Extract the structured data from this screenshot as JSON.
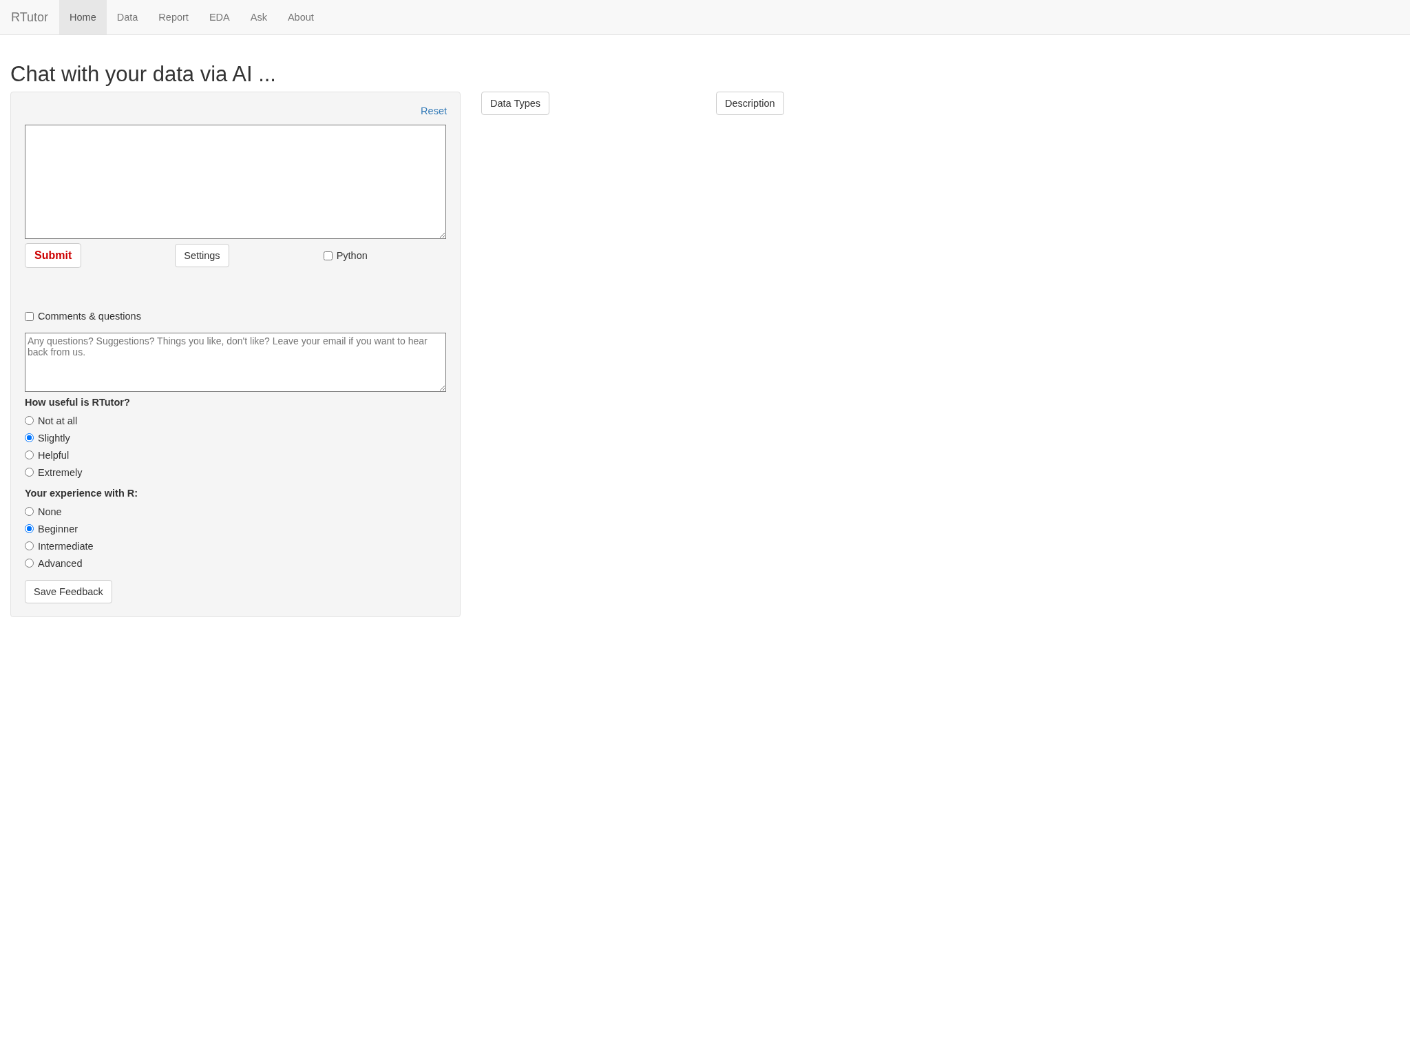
{
  "navbar": {
    "brand": "RTutor",
    "tabs": [
      {
        "label": "Home",
        "selected": true
      },
      {
        "label": "Data",
        "selected": false
      },
      {
        "label": "Report",
        "selected": false
      },
      {
        "label": "EDA",
        "selected": false
      },
      {
        "label": "Ask",
        "selected": false
      },
      {
        "label": "About",
        "selected": false
      }
    ]
  },
  "title": "Chat with your data via AI ...",
  "panel": {
    "reset_link": "Reset",
    "submit_button": "Submit",
    "settings_button": "Settings",
    "python_option": {
      "label": "Python",
      "checked": false
    },
    "comments_option": {
      "label": "Comments & questions",
      "checked": false
    },
    "comments_box": {
      "placeholder": "Any questions? Suggestions? Things you like, don't like? Leave your email if you want to hear back from us."
    },
    "questions": [
      {
        "label": "How useful is RTutor?",
        "options": [
          {
            "label": "Not at all",
            "selected": false
          },
          {
            "label": "Slightly",
            "selected": true
          },
          {
            "label": "Helpful",
            "selected": false
          },
          {
            "label": "Extremely",
            "selected": false
          }
        ]
      },
      {
        "label": "Your experience with R:",
        "options": [
          {
            "label": "None",
            "selected": false
          },
          {
            "label": "Beginner",
            "selected": true
          },
          {
            "label": "Intermediate",
            "selected": false
          },
          {
            "label": "Advanced",
            "selected": false
          }
        ]
      }
    ],
    "save_button": "Save Feedback"
  },
  "side_buttons": [
    "Data Types",
    "Description"
  ]
}
